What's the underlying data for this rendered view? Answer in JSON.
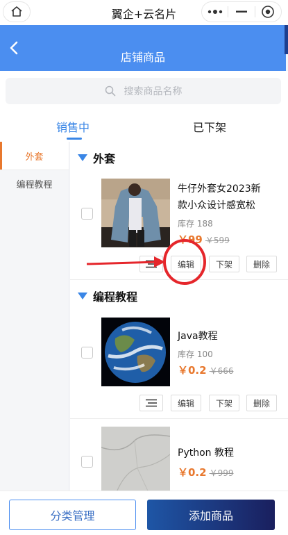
{
  "system": {
    "title": "翼企+云名片"
  },
  "header": {
    "title": "店铺商品"
  },
  "search": {
    "placeholder": "搜索商品名称"
  },
  "tabs": [
    {
      "label": "销售中",
      "active": true
    },
    {
      "label": "已下架",
      "active": false
    }
  ],
  "categories": [
    {
      "label": "外套",
      "active": true
    },
    {
      "label": "编程教程",
      "active": false
    }
  ],
  "sections": [
    {
      "title": "外套",
      "products": [
        {
          "name": "牛仔外套女2023新款小众设计感宽松",
          "stock": "库存 188",
          "price": "￥99",
          "old_price": "￥599"
        }
      ]
    },
    {
      "title": "编程教程",
      "products": [
        {
          "name": "Java教程",
          "stock": "库存 100",
          "price": "￥0.2",
          "old_price": "￥666"
        },
        {
          "name": "Python 教程",
          "price": "￥0.2",
          "old_price": "￥999"
        }
      ]
    }
  ],
  "actions": {
    "edit": "编辑",
    "unlist": "下架",
    "delete": "删除"
  },
  "bottom": {
    "category_btn": "分类管理",
    "add_btn": "添加商品"
  },
  "colors": {
    "header_blue": "#4b8ef0",
    "accent_orange": "#e8782e",
    "tab_blue": "#3a86e6",
    "annotation_red": "#e5262b"
  }
}
